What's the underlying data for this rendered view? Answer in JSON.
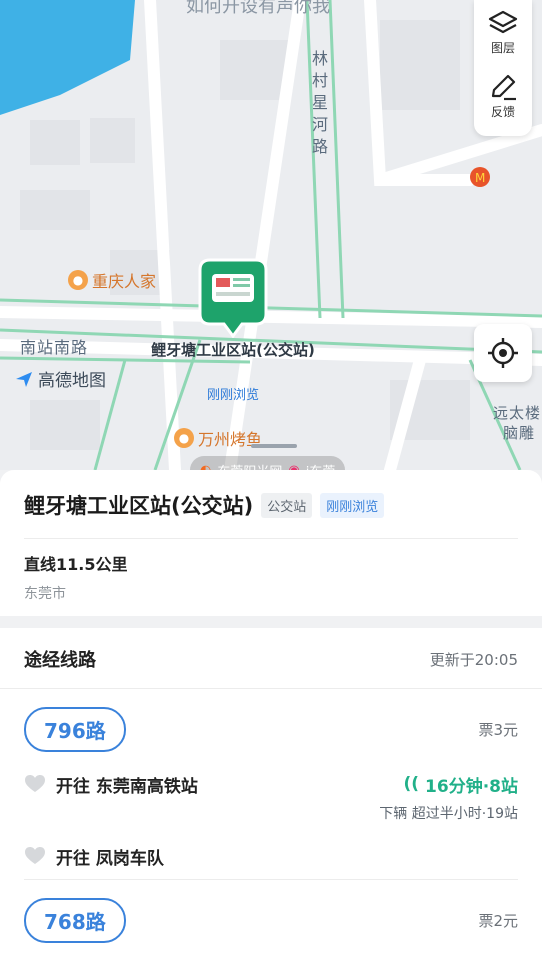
{
  "map": {
    "top_hint": "如何开设有声你我",
    "road_vertical": "林村星河路",
    "road_horizontal": "南站南路",
    "poi_restaurant": "重庆人家",
    "poi_bbq": "万州烤鱼",
    "building_right": "远太楼",
    "building_right2": "脑雕",
    "logo_text": "高德地图",
    "marker_name": "鲤牙塘工业区站(公交站)",
    "marker_tag": "刚刚浏览",
    "colors": {
      "road": "#ffffff",
      "bus_route": "#8fd7b4",
      "water": "#3fb1e6",
      "marker": "#1ea36b"
    }
  },
  "tools": {
    "layers_label": "图层",
    "feedback_label": "反馈",
    "layers_icon": "layers-icon",
    "feedback_icon": "pen-icon",
    "locate_icon": "crosshair-icon"
  },
  "watermark": {
    "left": "东莞阳光网",
    "right": "i东莞"
  },
  "stop": {
    "title": "鲤牙塘工业区站(公交站)",
    "type_badge": "公交站",
    "recent_badge": "刚刚浏览",
    "distance": "直线11.5公里",
    "city": "东莞市"
  },
  "routes": {
    "heading": "途经线路",
    "updated": "更新于20:05",
    "items": [
      {
        "name": "796路",
        "fare": "票3元",
        "dir1": "开往 东莞南高铁站",
        "eta": "16分钟·8站",
        "next": "下辆 超过半小时·19站",
        "dir2": "开往 凤岗车队"
      },
      {
        "name": "768路",
        "fare": "票2元"
      }
    ]
  }
}
